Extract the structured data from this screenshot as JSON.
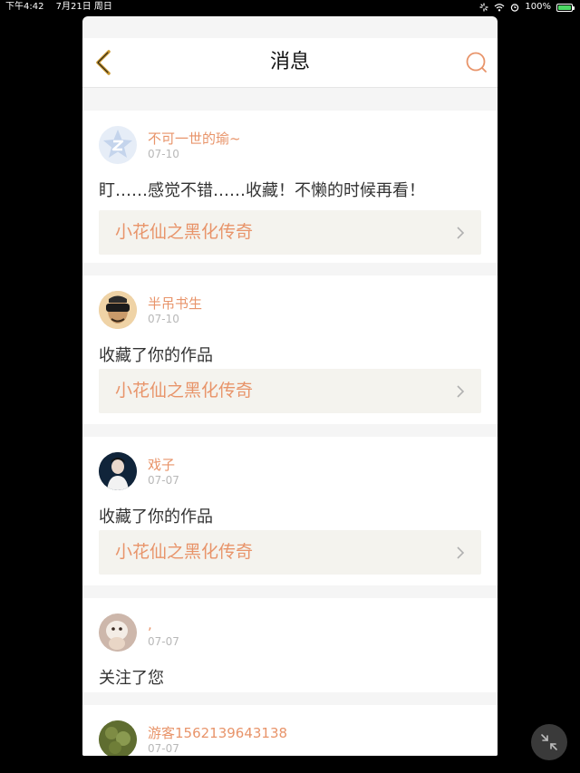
{
  "status_bar": {
    "time": "下午4:42",
    "date": "7月21日 周日",
    "battery_text": "100%",
    "battery_level": 1.0
  },
  "nav": {
    "title": "消息",
    "back_icon": "chevron-left-icon",
    "search_icon": "search-icon"
  },
  "colors": {
    "accent": "#e8946a",
    "nav_icon": "#c8962e",
    "date_text": "#b8b8b8",
    "link_bg": "#f4f3ee"
  },
  "messages": [
    {
      "username": "不可一世的瑜~",
      "date": "07-10",
      "text": "盯……感觉不错……收藏！不懒的时候再看！",
      "work_title": "小花仙之黑化传奇",
      "avatar": "qzone-default-avatar"
    },
    {
      "username": "半吊书生",
      "date": "07-10",
      "text": "收藏了你的作品",
      "work_title": "小花仙之黑化传奇",
      "avatar": "photo-avatar"
    },
    {
      "username": "戏子",
      "date": "07-07",
      "text": "收藏了你的作品",
      "work_title": "小花仙之黑化传奇",
      "avatar": "photo-avatar"
    },
    {
      "username": ",",
      "date": "07-07",
      "text": "关注了您",
      "avatar": "photo-avatar"
    },
    {
      "username": "游客1562139643138",
      "date": "07-07",
      "avatar": "photo-avatar"
    }
  ],
  "overlay": {
    "collapse_icon": "collapse-arrows-icon"
  }
}
